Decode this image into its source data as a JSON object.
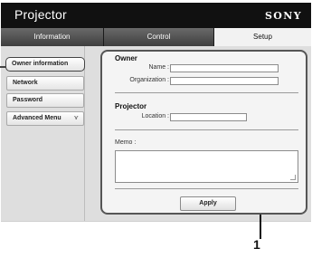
{
  "header": {
    "title": "Projector",
    "brand": "SONY"
  },
  "tabs": [
    {
      "label": "Information",
      "active": false
    },
    {
      "label": "Control",
      "active": false
    },
    {
      "label": "Setup",
      "active": true
    }
  ],
  "sidebar": {
    "items": [
      {
        "label": "Owner information",
        "selected": true
      },
      {
        "label": "Network",
        "selected": false
      },
      {
        "label": "Password",
        "selected": false
      },
      {
        "label": "Advanced Menu",
        "selected": false,
        "icon": "double-chevron-down-icon"
      }
    ]
  },
  "owner": {
    "title": "Owner",
    "name_label": "Name :",
    "name_value": "",
    "organization_label": "Organization :",
    "organization_value": ""
  },
  "projector": {
    "title": "Projector",
    "location_label": "Location :",
    "location_value": ""
  },
  "memo": {
    "label": "Memo :",
    "value": ""
  },
  "apply_label": "Apply",
  "callout": {
    "number": "1"
  },
  "colors": {
    "header_bg": "#111111",
    "panel_border": "#555555",
    "content_bg": "#dedede"
  }
}
